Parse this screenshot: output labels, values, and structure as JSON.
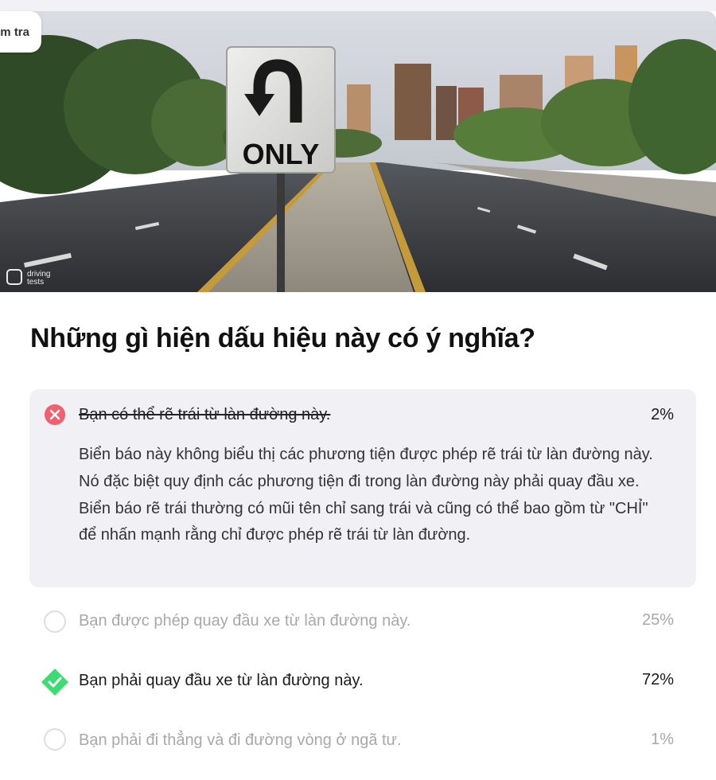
{
  "quiz_tab": {
    "label": "Kiểm tra"
  },
  "image": {
    "sign_text": "ONLY",
    "watermark_line1": "driving",
    "watermark_line2": "tests"
  },
  "question": {
    "text": "Những gì hiện dấu hiệu này có ý nghĩa?"
  },
  "answers": [
    {
      "text": "Bạn có thể rẽ trái từ làn đường này.",
      "percent": "2%",
      "status": "incorrect",
      "explanation": "Biển báo này không biểu thị các phương tiện được phép rẽ trái từ làn đường này. Nó đặc biệt quy định các phương tiện đi trong làn đường này phải quay đầu xe. Biển báo rẽ trái thường có mũi tên chỉ sang trái và cũng có thể bao gồm từ \"CHỈ\" để nhấn mạnh rằng chỉ được phép rẽ trái từ làn đường."
    },
    {
      "text": "Bạn được phép quay đầu xe từ làn đường này.",
      "percent": "25%",
      "status": "unselected"
    },
    {
      "text": "Bạn phải quay đầu xe từ làn đường này.",
      "percent": "72%",
      "status": "correct"
    },
    {
      "text": "Bạn phải đi thẳng và đi đường vòng ở ngã tư.",
      "percent": "1%",
      "status": "unselected"
    }
  ],
  "colors": {
    "incorrect": "#f0606e",
    "correct": "#3ddc72",
    "expanded_bg": "#f0f0f5",
    "dim_text": "#a8a8a8"
  }
}
